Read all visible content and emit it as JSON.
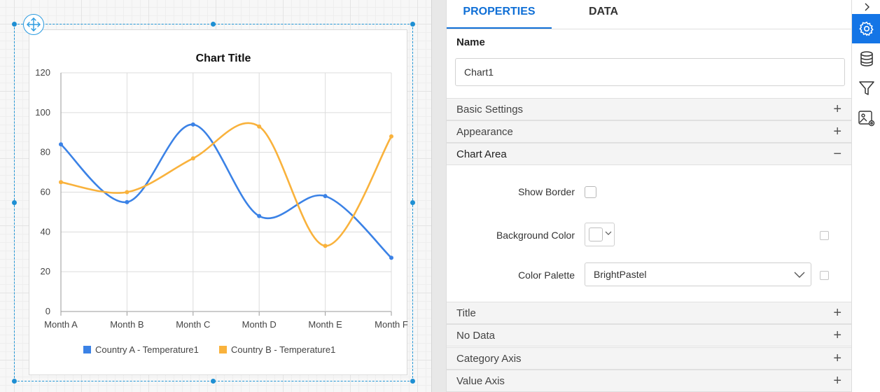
{
  "panel": {
    "tabs": [
      {
        "label": "PROPERTIES",
        "active": true
      },
      {
        "label": "DATA",
        "active": false
      }
    ],
    "name_label": "Name",
    "name_value": "Chart1",
    "sections": {
      "basic_settings": {
        "label": "Basic Settings",
        "toggle": "+"
      },
      "appearance": {
        "label": "Appearance",
        "toggle": "+"
      },
      "chart_area": {
        "label": "Chart Area",
        "toggle": "−"
      },
      "title": {
        "label": "Title",
        "toggle": "+"
      },
      "no_data": {
        "label": "No Data",
        "toggle": "+"
      },
      "category_axis": {
        "label": "Category Axis",
        "toggle": "+"
      },
      "value_axis": {
        "label": "Value Axis",
        "toggle": "+"
      }
    },
    "chart_area": {
      "show_border_label": "Show Border",
      "show_border_checked": false,
      "background_color_label": "Background Color",
      "background_color_value": "#ffffff",
      "color_palette_label": "Color Palette",
      "color_palette_value": "BrightPastel"
    }
  },
  "rail": {
    "collapse_icon": "chevron-right-icon",
    "buttons": [
      "gear-icon",
      "database-icon",
      "filter-icon",
      "image-settings-icon"
    ],
    "active": "gear-icon"
  },
  "colors": {
    "accent": "#1475e6",
    "tab_active": "#0f6fd6",
    "selection": "#1e8fd3"
  },
  "chart_data": {
    "type": "line",
    "smooth": true,
    "title": "Chart Title",
    "categories": [
      "Month A",
      "Month B",
      "Month C",
      "Month D",
      "Month E",
      "Month F"
    ],
    "series": [
      {
        "name": "Country A - Temperature1",
        "color": "#3b82e6",
        "values": [
          84,
          55,
          94,
          48,
          58,
          27
        ]
      },
      {
        "name": "Country B - Temperature1",
        "color": "#f9b23c",
        "values": [
          65,
          60,
          77,
          93,
          33,
          88
        ]
      }
    ],
    "ylim": [
      0,
      120
    ],
    "yticks": [
      0,
      20,
      40,
      60,
      80,
      100,
      120
    ],
    "grid": true,
    "legend": "bottom"
  }
}
